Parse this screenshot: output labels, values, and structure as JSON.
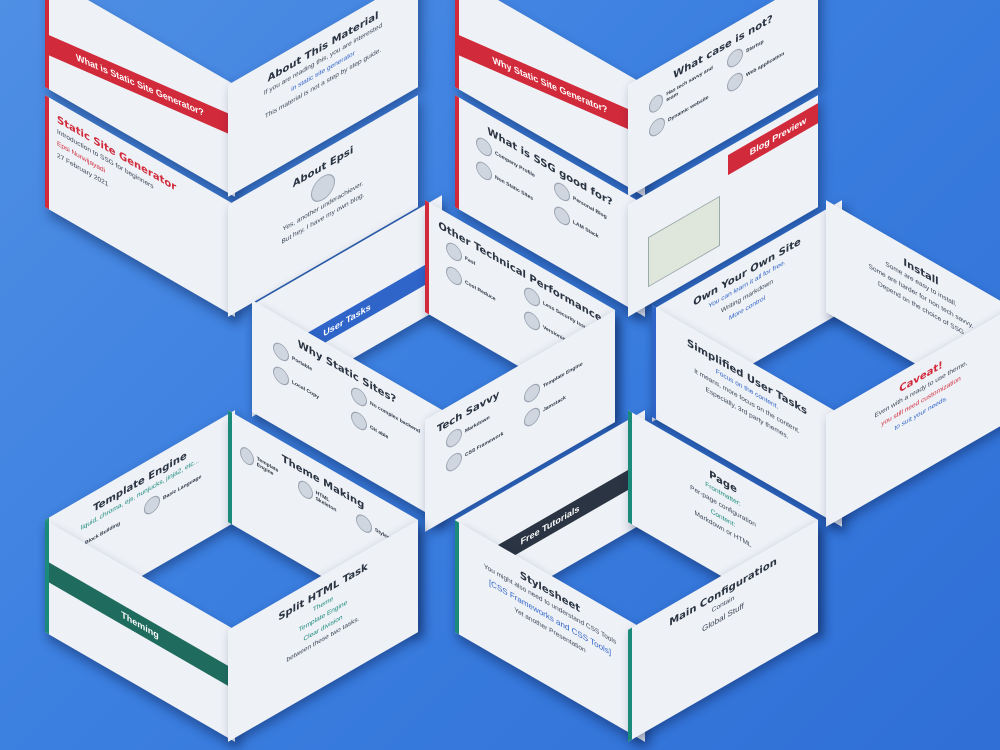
{
  "slides": {
    "s1": {
      "band": "What is Static Site Generator?"
    },
    "s2": {
      "title": "About This Material",
      "line1": "If you are reading this, you are interested",
      "line2": "in static site generator",
      "line3": "This material is not a step by step guide."
    },
    "s3": {
      "title": "Static Site Generator",
      "sub": "Introduction to SSG for beginners",
      "author": "Epsi Nurwijayadi",
      "date": "27 February 2021"
    },
    "s4": {
      "title": "About Epsi",
      "line1": "Yes, another underachiever.",
      "line2": "But hey, I have my own blog."
    },
    "s5": {
      "band": "Why Static Site Generator?"
    },
    "s6": {
      "title": "What case is not?",
      "items": [
        "Has tech savvy and team",
        "Dynamic website",
        "Startup",
        "Web application"
      ]
    },
    "s7": {
      "title": "What is SSG good for?",
      "items": [
        "Company Profile",
        "Personal Blog",
        "Non Static Sites",
        "LAM Stack",
        "Official Site"
      ]
    },
    "s8": {
      "band": "Blog Preview"
    },
    "s9": {
      "band": "User Tasks"
    },
    "s10": {
      "title": "Other Technical Performance",
      "items": [
        "Fast",
        "Less Security Issue",
        "Cost Reduce",
        "Versioning"
      ]
    },
    "s11": {
      "title": "Own Your Own Site",
      "sub": "You can learn it all for free.",
      "line": "Writing markdown",
      "more": "More control"
    },
    "s12": {
      "title": "Install",
      "line1": "Some are easy to install.",
      "line2": "Some are harder for non tech savvy.",
      "line3": "Depend on the choice of SSG"
    },
    "s13": {
      "title": "Why Static Sites?",
      "items": [
        "Portable",
        "Local Copy",
        "No complex backend",
        "Git able"
      ]
    },
    "s14": {
      "title": "Tech Savvy",
      "items": [
        "Markdown",
        "Template Engine",
        "CSS Framework",
        "Jamstack"
      ]
    },
    "s15": {
      "title": "Simplified User Tasks",
      "line1": "Focus on the content.",
      "line2": "It means, more focus on the content.",
      "line3": "Especially, 3rd party themes."
    },
    "s16": {
      "title": "Caveat!",
      "line1": "Even with a ready to use theme,",
      "line2": "you still need customization",
      "line3": "to suit your needs."
    },
    "s17": {
      "title": "Template Engine",
      "sub": "liquid, chroma, ejs, nunjucks, jinja2, etc...",
      "items": [
        "Block Building",
        "Basic Language",
        "Data Files",
        "Specific Feature"
      ]
    },
    "s18": {
      "title": "Theme Making",
      "items": [
        "Template Engine",
        "HTML Skeleton",
        "Stylesheet"
      ]
    },
    "s19": {
      "band": "Free Tutorials"
    },
    "s20": {
      "title": "Page",
      "line1": "Frontmatter:",
      "line2": "Per-page configuration",
      "line3": "Content:",
      "line4": "Markdown or HTML"
    },
    "s21": {
      "band": "Theming"
    },
    "s22": {
      "title": "Split HTML Task",
      "line1": "Theme",
      "line2": "Template Engine",
      "line3": "Clear division",
      "line4": "between these two tasks."
    },
    "s23": {
      "title": "Stylesheet",
      "line1": "You might also need to understand CSS Tools",
      "line2": "[CSS Frameworks and CSS Tools]",
      "line3": "Yet another Presentation"
    },
    "s24": {
      "title": "Main Configuration",
      "line1": "Contain",
      "line2": "Global Stuff"
    }
  },
  "footer": "Static Site Generator",
  "colors": {
    "red": "#d12a3a",
    "blue": "#2f64c8",
    "teal": "#1a8a7a",
    "navy": "#2a3442"
  }
}
